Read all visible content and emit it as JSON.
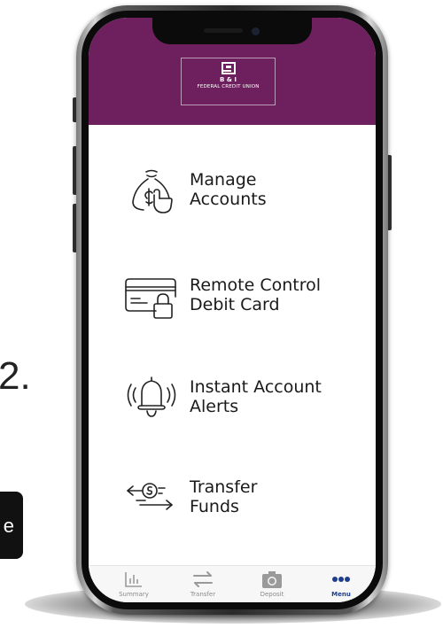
{
  "side": {
    "step_number": "2.",
    "tag_text": "e"
  },
  "header": {
    "logo_line1": "B & I",
    "logo_line2": "FEDERAL CREDIT UNION",
    "brand_color": "#6d1f5e"
  },
  "menu": {
    "items": [
      {
        "line1": "Manage",
        "line2": "Accounts",
        "icon": "money-bag-hand-icon"
      },
      {
        "line1": "Remote Control",
        "line2": "Debit Card",
        "icon": "card-lock-icon"
      },
      {
        "line1": "Instant Account",
        "line2": "Alerts",
        "icon": "bell-alert-icon"
      },
      {
        "line1": "Transfer",
        "line2": "Funds",
        "icon": "transfer-coin-icon"
      }
    ]
  },
  "tabbar": {
    "tabs": [
      {
        "label": "Summary",
        "icon": "bar-chart-icon"
      },
      {
        "label": "Transfer",
        "icon": "swap-arrows-icon"
      },
      {
        "label": "Deposit",
        "icon": "camera-icon"
      },
      {
        "label": "Menu",
        "icon": "more-dots-icon",
        "active": true
      }
    ],
    "active_color": "#1d3d8f"
  }
}
